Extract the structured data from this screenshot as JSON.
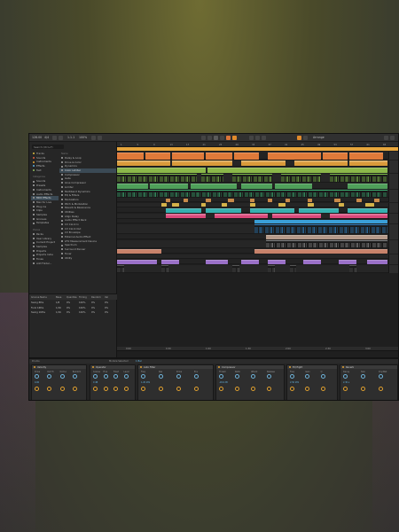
{
  "app": {
    "name": "Bitwig Studio",
    "accent_color": "#e08a2c"
  },
  "transport": {
    "tempo": "128.00",
    "signature": "4/4",
    "position": "1.1.1",
    "zoom": "100%",
    "mode_label": "Arrange"
  },
  "browser": {
    "search_placeholder": "Search (Ctrl+F)",
    "categories": [
      {
        "label": "Tracks",
        "color": "#e0c040"
      },
      {
        "label": "Sounds",
        "color": "#e06040"
      },
      {
        "label": "Instruments",
        "color": "#e0a030"
      },
      {
        "label": "Effects",
        "color": "#60b0e0"
      },
      {
        "label": "Text",
        "color": "#90c060"
      }
    ],
    "categories_head": "Categories",
    "locations": [
      {
        "label": "Sounds"
      },
      {
        "label": "Presets"
      },
      {
        "label": "Instruments"
      },
      {
        "label": "Audio Effects"
      },
      {
        "label": "MIDI Effects"
      },
      {
        "label": "Max for Live"
      },
      {
        "label": "Plug-ins"
      },
      {
        "label": "Clips"
      },
      {
        "label": "Samples"
      },
      {
        "label": "Grooves"
      },
      {
        "label": "Templates"
      }
    ],
    "places_head": "Places",
    "places": [
      {
        "label": "Packs"
      },
      {
        "label": "User Library"
      },
      {
        "label": "Current Project"
      },
      {
        "label": "Samples"
      },
      {
        "label": "Projects"
      },
      {
        "label": "Projects Indie"
      },
      {
        "label": "Tones"
      },
      {
        "label": "Add Folder..."
      }
    ],
    "list_head": "Name",
    "list": [
      {
        "label": "Delay & Loop"
      },
      {
        "label": "Drive & Color"
      },
      {
        "label": "Dynamics"
      },
      {
        "label": "Color Limiter",
        "selected": true
      },
      {
        "label": "Compressor"
      },
      {
        "label": "Gate"
      },
      {
        "label": "Glue Compressor"
      },
      {
        "label": "Limiter"
      },
      {
        "label": "Multiband Dynamics"
      },
      {
        "label": "EQ & Filters"
      },
      {
        "label": "Modulators"
      },
      {
        "label": "Pitch & Modulation"
      },
      {
        "label": "Reverb & Resonance"
      },
      {
        "label": "Utilities"
      },
      {
        "label": "Align Delay"
      },
      {
        "label": "Audio Effect Rack"
      },
      {
        "label": "CV Clock In"
      },
      {
        "label": "CV Clock Out"
      },
      {
        "label": "CV Envelope"
      },
      {
        "label": "External Audio Effect"
      },
      {
        "label": "LFO Measurement Device"
      },
      {
        "label": "Spectrum"
      },
      {
        "label": "Surround Panner"
      },
      {
        "label": "Tuner"
      },
      {
        "label": "Utility"
      }
    ]
  },
  "groove_pool": {
    "columns": [
      "Groove Name",
      "Base",
      "Quantize",
      "Timing",
      "Random",
      "Vel"
    ],
    "rows": [
      {
        "name": "Swing 8ths",
        "base": "1/8",
        "quantize": "0%",
        "timing": "100%",
        "random": "0%",
        "vel": "0%"
      },
      {
        "name": "Funk 16ths",
        "base": "1/16",
        "quantize": "0%",
        "timing": "100%",
        "random": "0%",
        "vel": "0%"
      },
      {
        "name": "Swing 16ths",
        "base": "1/16",
        "quantize": "0%",
        "timing": "100%",
        "random": "0%",
        "vel": "0%"
      }
    ]
  },
  "arrangement": {
    "ruler": [
      "1",
      "5",
      "9",
      "13",
      "17",
      "21",
      "25",
      "29",
      "33",
      "37",
      "41",
      "45",
      "49",
      "53",
      "57",
      "61",
      "65"
    ],
    "time_ruler": [
      "0:00",
      "0:30",
      "1:00",
      "1:30",
      "2:00",
      "2:30",
      "3:00"
    ],
    "scene_color": "#e6a53c"
  },
  "status_bar": {
    "left": "Drums",
    "center": "Module Selected",
    "right": "1 Bar"
  },
  "devices": [
    {
      "title": "Velocity",
      "params": [
        "Drive",
        "Out Hi",
        "Out Lo",
        "Random"
      ],
      "value": "0.00"
    },
    {
      "title": "Operator",
      "params": [
        "Coarse",
        "Fine",
        "Fixed",
        "Level"
      ],
      "value": "0 dB"
    },
    {
      "title": "Auto Filter",
      "params": [
        "Freq",
        "Res",
        "Drive",
        "Env"
      ],
      "value": "1.20 kHz"
    },
    {
      "title": "Compressor",
      "params": [
        "Thresh",
        "Ratio",
        "Attack",
        "Release"
      ],
      "value": "-18.0 dB"
    },
    {
      "title": "EQ Eight",
      "params": [
        "Freq",
        "Gain",
        "Q"
      ],
      "value": "2.50 kHz"
    },
    {
      "title": "Reverb",
      "params": [
        "Decay",
        "Size",
        "Dry/Wet"
      ],
      "value": "2.30 s"
    }
  ]
}
